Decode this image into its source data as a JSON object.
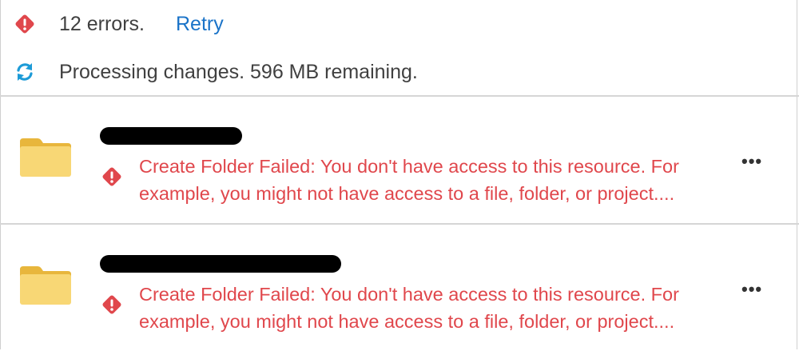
{
  "status": {
    "errors_label": "12 errors.",
    "retry_label": "Retry",
    "processing_label": "Processing changes. 596 MB remaining."
  },
  "items": [
    {
      "name": "",
      "error_message": "Create Folder Failed: You don't have access to this resource. For example, you might not have access to a file, folder, or project....",
      "more_label": "•••"
    },
    {
      "name": "",
      "error_message": "Create Folder Failed: You don't have access to this resource. For example, you might not have access to a file, folder, or project....",
      "more_label": "•••"
    }
  ],
  "colors": {
    "error_red": "#e0474c",
    "link_blue": "#1a73c8",
    "sync_blue": "#1d9bd7",
    "folder_yellow": "#f8d775"
  },
  "icons": {
    "error": "error-diamond-icon",
    "sync": "sync-icon",
    "folder": "folder-icon",
    "more": "more-options-icon"
  }
}
